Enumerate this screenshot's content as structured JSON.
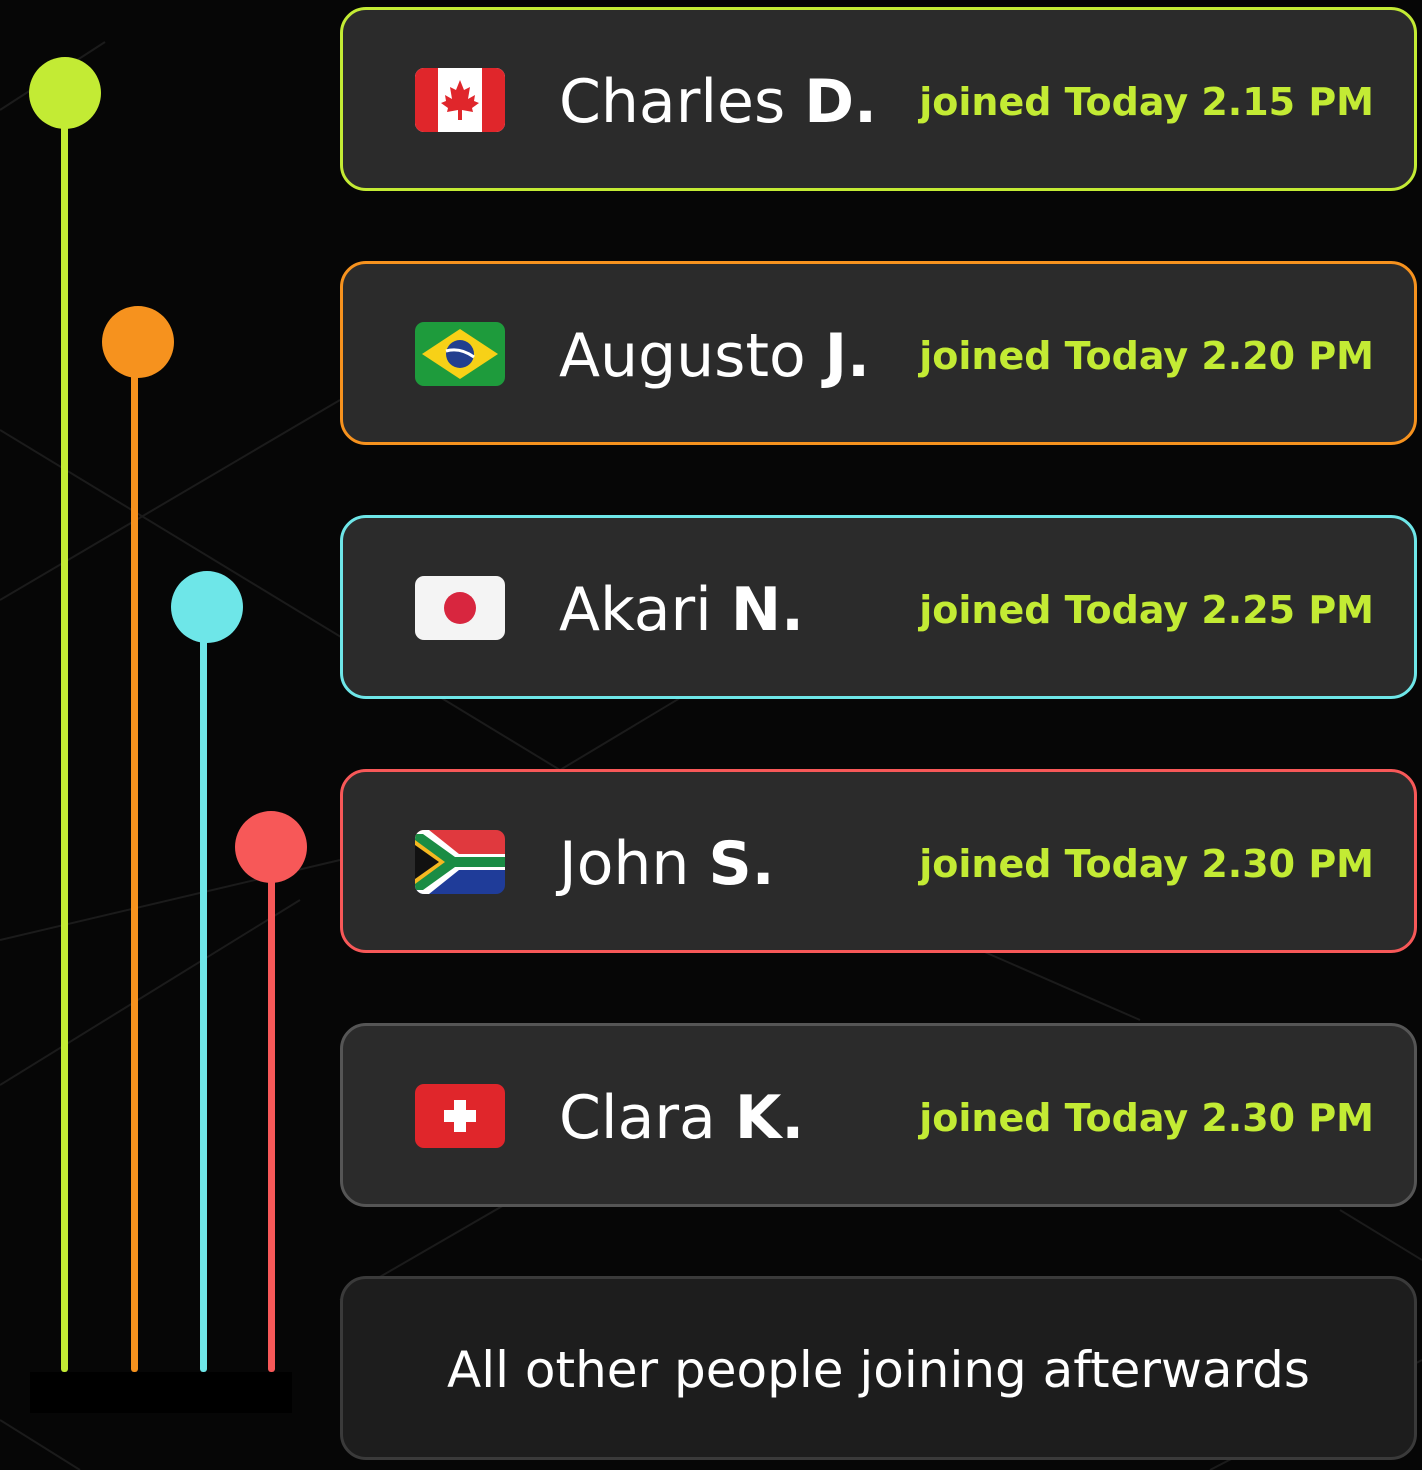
{
  "colors": {
    "background": "#060606",
    "card_background": "#2b2b2b",
    "joined_text": "#c3eb34",
    "green": "#c3eb34",
    "orange": "#f6921e",
    "cyan": "#6ee6e8",
    "red": "#f75858",
    "gray_border": "#555555"
  },
  "members": [
    {
      "first_name": "Charles",
      "last_initial": "D.",
      "joined": "joined Today 2.15 PM",
      "flag_icon": "canada-flag-icon",
      "accent": "#c3eb34"
    },
    {
      "first_name": "Augusto",
      "last_initial": "J.",
      "joined": "joined Today 2.20 PM",
      "flag_icon": "brazil-flag-icon",
      "accent": "#f6921e"
    },
    {
      "first_name": "Akari",
      "last_initial": "N.",
      "joined": "joined Today 2.25 PM",
      "flag_icon": "japan-flag-icon",
      "accent": "#6ee6e8"
    },
    {
      "first_name": "John",
      "last_initial": "S.",
      "joined": "joined Today 2.30 PM",
      "flag_icon": "south-africa-flag-icon",
      "accent": "#f75858"
    },
    {
      "first_name": "Clara",
      "last_initial": "K.",
      "joined": "joined Today 2.30 PM",
      "flag_icon": "switzerland-flag-icon",
      "accent": "#555555"
    }
  ],
  "footer": {
    "text": "All other people joining afterwards"
  }
}
